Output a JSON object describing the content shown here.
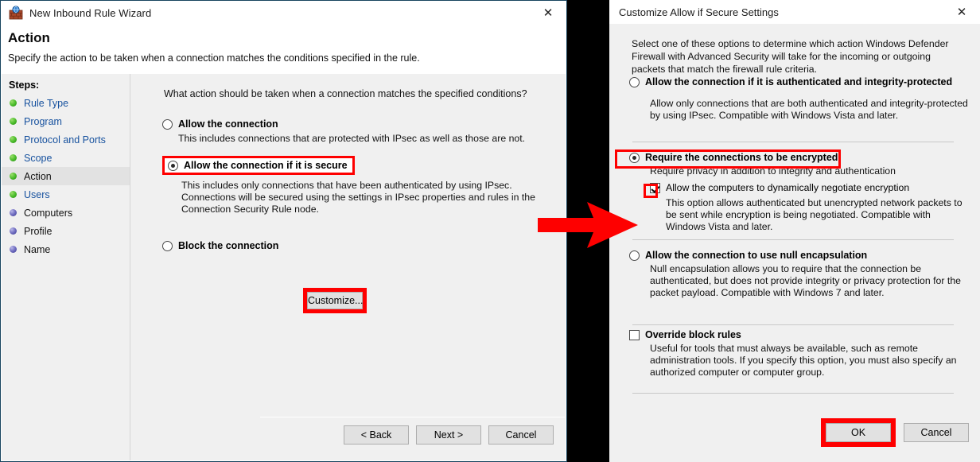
{
  "wizard": {
    "title": "New Inbound Rule Wizard",
    "icon": "firewall-brick-icon",
    "close_icon": "close-icon",
    "page_title": "Action",
    "page_subtitle": "Specify the action to be taken when a connection matches the conditions specified in the rule.",
    "steps_title": "Steps:",
    "steps": [
      {
        "label": "Rule Type",
        "state": "done"
      },
      {
        "label": "Program",
        "state": "done"
      },
      {
        "label": "Protocol and Ports",
        "state": "done"
      },
      {
        "label": "Scope",
        "state": "done"
      },
      {
        "label": "Action",
        "state": "current"
      },
      {
        "label": "Users",
        "state": "done"
      },
      {
        "label": "Computers",
        "state": "todo"
      },
      {
        "label": "Profile",
        "state": "todo"
      },
      {
        "label": "Name",
        "state": "todo"
      }
    ],
    "question": "What action should be taken when a connection matches the specified conditions?",
    "options": [
      {
        "label": "Allow the connection",
        "selected": false,
        "desc": "This includes connections that are protected with IPsec as well as those are not."
      },
      {
        "label": "Allow the connection if it is secure",
        "selected": true,
        "desc": "This includes only connections that have been authenticated by using IPsec.  Connections will be secured using the settings in IPsec properties and rules in the Connection Security Rule node."
      },
      {
        "label": "Block the connection",
        "selected": false,
        "desc": ""
      }
    ],
    "customize_button": "Customize...",
    "footer": {
      "back": "< Back",
      "next": "Next >",
      "cancel": "Cancel"
    }
  },
  "dialog": {
    "title": "Customize Allow if Secure Settings",
    "close_icon": "close-icon",
    "intro": "Select one of these options to determine which action Windows Defender Firewall with Advanced Security will take for the incoming or outgoing packets that match the firewall rule criteria.",
    "options": [
      {
        "label": "Allow the connection if it is authenticated and integrity-protected",
        "selected": false,
        "desc": "Allow only connections that are both authenticated and integrity-protected by using IPsec. Compatible with Windows Vista and later."
      },
      {
        "label": "Require the connections to be encrypted",
        "selected": true,
        "desc": "Require privacy in addition to integrity and authentication",
        "checkbox": {
          "label": "Allow the computers to dynamically negotiate encryption",
          "checked": true,
          "desc": "This option allows authenticated but unencrypted network packets to be sent while encryption is being negotiated. Compatible with Windows Vista and later."
        }
      },
      {
        "label": "Allow the connection to use null encapsulation",
        "selected": false,
        "desc": "Null encapsulation allows you to require that the connection be authenticated, but does not provide integrity or privacy protection for the packet payload. Compatible with Windows 7 and later."
      }
    ],
    "override": {
      "label": "Override block rules",
      "checked": false,
      "desc": "Useful for tools that must always be available, such as remote administration tools. If you specify this option, you must also specify an authorized computer or computer group."
    },
    "footer": {
      "ok": "OK",
      "cancel": "Cancel"
    }
  },
  "annotation": {
    "arrow_icon": "right-arrow-annotation",
    "highlight_color": "#fe0000"
  }
}
